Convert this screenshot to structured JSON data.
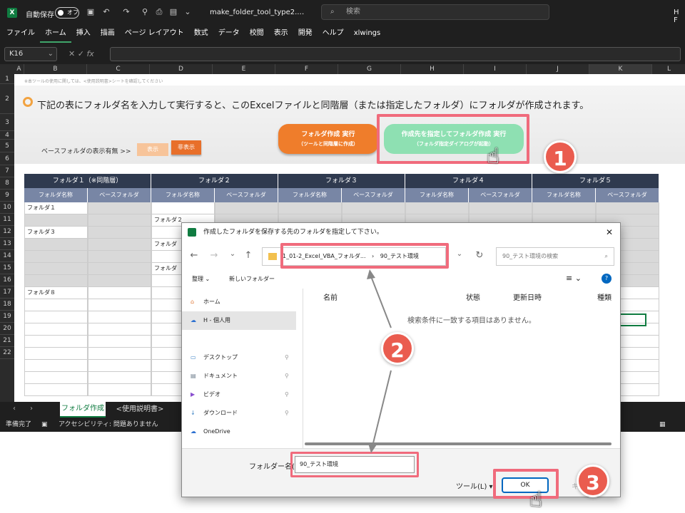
{
  "titlebar": {
    "autosave": "自動保存",
    "autosave_state": "オフ",
    "filename": "make_folder_tool_type2.…",
    "search_placeholder": "検索",
    "user_initials": "H F"
  },
  "menu": [
    "ファイル",
    "ホーム",
    "挿入",
    "描画",
    "ページ レイアウト",
    "数式",
    "データ",
    "校閲",
    "表示",
    "開発",
    "ヘルプ",
    "xlwings"
  ],
  "menu_active": "ホーム",
  "formula": {
    "namebox": "K16",
    "fx": "fx"
  },
  "columns": [
    "A",
    "B",
    "C",
    "D",
    "E",
    "F",
    "G",
    "H",
    "I",
    "J",
    "K",
    "L"
  ],
  "rows": [
    "1",
    "2",
    "3",
    "4",
    "5",
    "6",
    "7",
    "8",
    "9",
    "10",
    "11",
    "12",
    "13",
    "14",
    "15",
    "16",
    "17",
    "18",
    "19",
    "20",
    "21",
    "22"
  ],
  "sheet": {
    "note": "※本ツールの使用に関しては、<使用説明書>シートを確認してください",
    "banner": "下記の表にフォルダ名を入力して実行すると、このExcelファイルと同階層（または指定したフォルダ）にフォルダが作成されます。",
    "btn_local": {
      "title": "フォルダ作成 実行",
      "sub": "（ツールと同階層に作成）"
    },
    "btn_pick": {
      "title": "作成先を指定してフォルダ作成 実行",
      "sub": "（フォルダ指定ダイアログが起動）"
    },
    "base_label": "ベースフォルダの表示有無 >>",
    "base_show": "表示",
    "base_hide": "非表示",
    "groups": [
      "フォルダ１（※同階層）",
      "フォルダ２",
      "フォルダ３",
      "フォルダ４",
      "フォルダ５"
    ],
    "sub_name": "フォルダ名称",
    "sub_base": "ベースフォルダ",
    "cells": {
      "r7": "フォルダ１",
      "r8": "フォルダ２",
      "r9": "フォルダ３",
      "r10": "フォルダ",
      "r12": "フォルダ",
      "r14": "フォルダ８"
    }
  },
  "tabs": {
    "active": "フォルダ作成",
    "other": "<使用説明書>"
  },
  "status": {
    "ready": "準備完了",
    "access": "アクセシビリティ: 問題ありません"
  },
  "dialog": {
    "title": "作成したフォルダを保存する先のフォルダを指定して下さい。",
    "path1": "1_01-2_Excel_VBA_フォルダ...",
    "path2": "90_テスト環境",
    "search_placeholder": "90_テスト環境の検索",
    "organize": "整理",
    "new_folder": "新しいフォルダー",
    "nav": [
      "ホーム",
      "H - 個人用",
      "デスクトップ",
      "ドキュメント",
      "ビデオ",
      "ダウンロード",
      "OneDrive"
    ],
    "col_name": "名前",
    "col_status": "状態",
    "col_date": "更新日時",
    "col_type": "種類",
    "empty": "検索条件に一致する項目はありません。",
    "folder_label": "フォルダー名(N):",
    "folder_value": "90_テスト環境",
    "tools": "ツール(L)",
    "ok": "OK",
    "cancel": "キ"
  },
  "badges": [
    "1",
    "2",
    "3"
  ],
  "colors": {
    "accent_red": "#f06b7c",
    "badge": "#ea5c4f",
    "excel_green": "#107c41",
    "btn_orange": "#ef7d2b",
    "btn_green": "#8ee0b2",
    "header_dark": "#2f3a4f",
    "header_mid": "#7886a5"
  }
}
